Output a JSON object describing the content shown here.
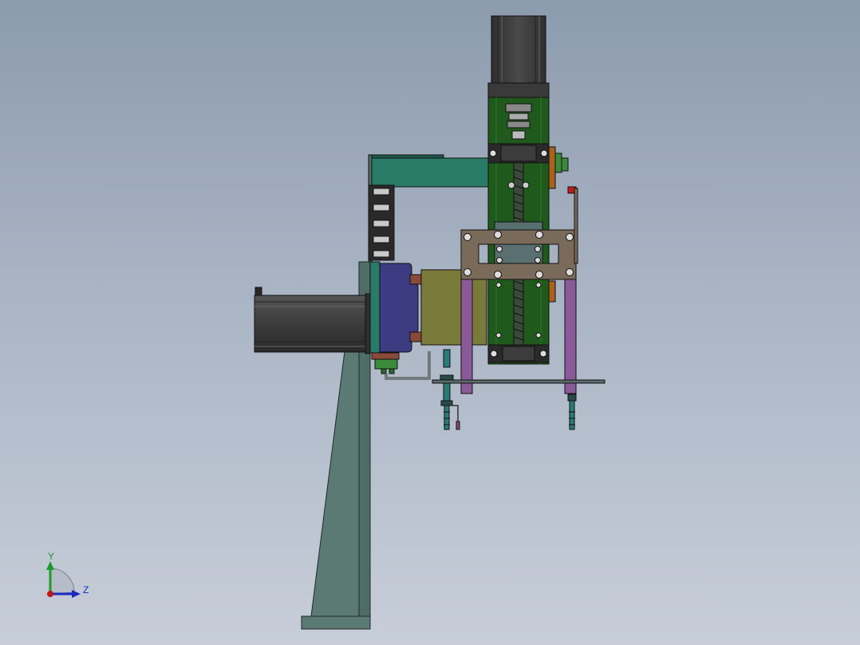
{
  "viewport": {
    "background_top": "#8c9bae",
    "background_bottom": "#c7ced9"
  },
  "triad": {
    "y_label": "Y",
    "z_label": "Z",
    "y_color": "#1e9a2a",
    "z_color": "#1a2bc0",
    "x_color": "#c01818"
  },
  "colors": {
    "motor_body": "#3c3c3c",
    "motor_dark": "#1e1e1e",
    "green_plate": "#1f5a1c",
    "teal": "#2a7a68",
    "brown_plate": "#7a6a5a",
    "purple_leg": "#8a5a98",
    "olive_block": "#7a7a3a",
    "navy_flange": "#3d3c82",
    "column": "#5c7a74",
    "red_marker": "#c21a1a",
    "orange_tab": "#a8621e"
  }
}
